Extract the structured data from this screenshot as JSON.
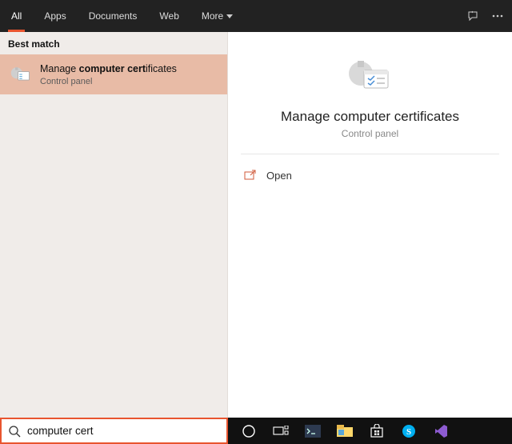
{
  "tabs": {
    "all": "All",
    "apps": "Apps",
    "documents": "Documents",
    "web": "Web",
    "more": "More"
  },
  "left": {
    "best_match_header": "Best match",
    "result": {
      "title_prefix": "Manage ",
      "title_bold": "computer cert",
      "title_suffix": "ificates",
      "subtitle": "Control panel"
    }
  },
  "detail": {
    "title": "Manage computer certificates",
    "subtitle": "Control panel",
    "open_label": "Open"
  },
  "search": {
    "value": "computer cert",
    "placeholder": ""
  },
  "icons": {
    "feedback": "feedback-icon",
    "ellipsis": "ellipsis-icon",
    "search": "search-icon",
    "cert_small": "cert-small-icon",
    "cert_large": "cert-large-icon",
    "open_action": "open-icon"
  }
}
